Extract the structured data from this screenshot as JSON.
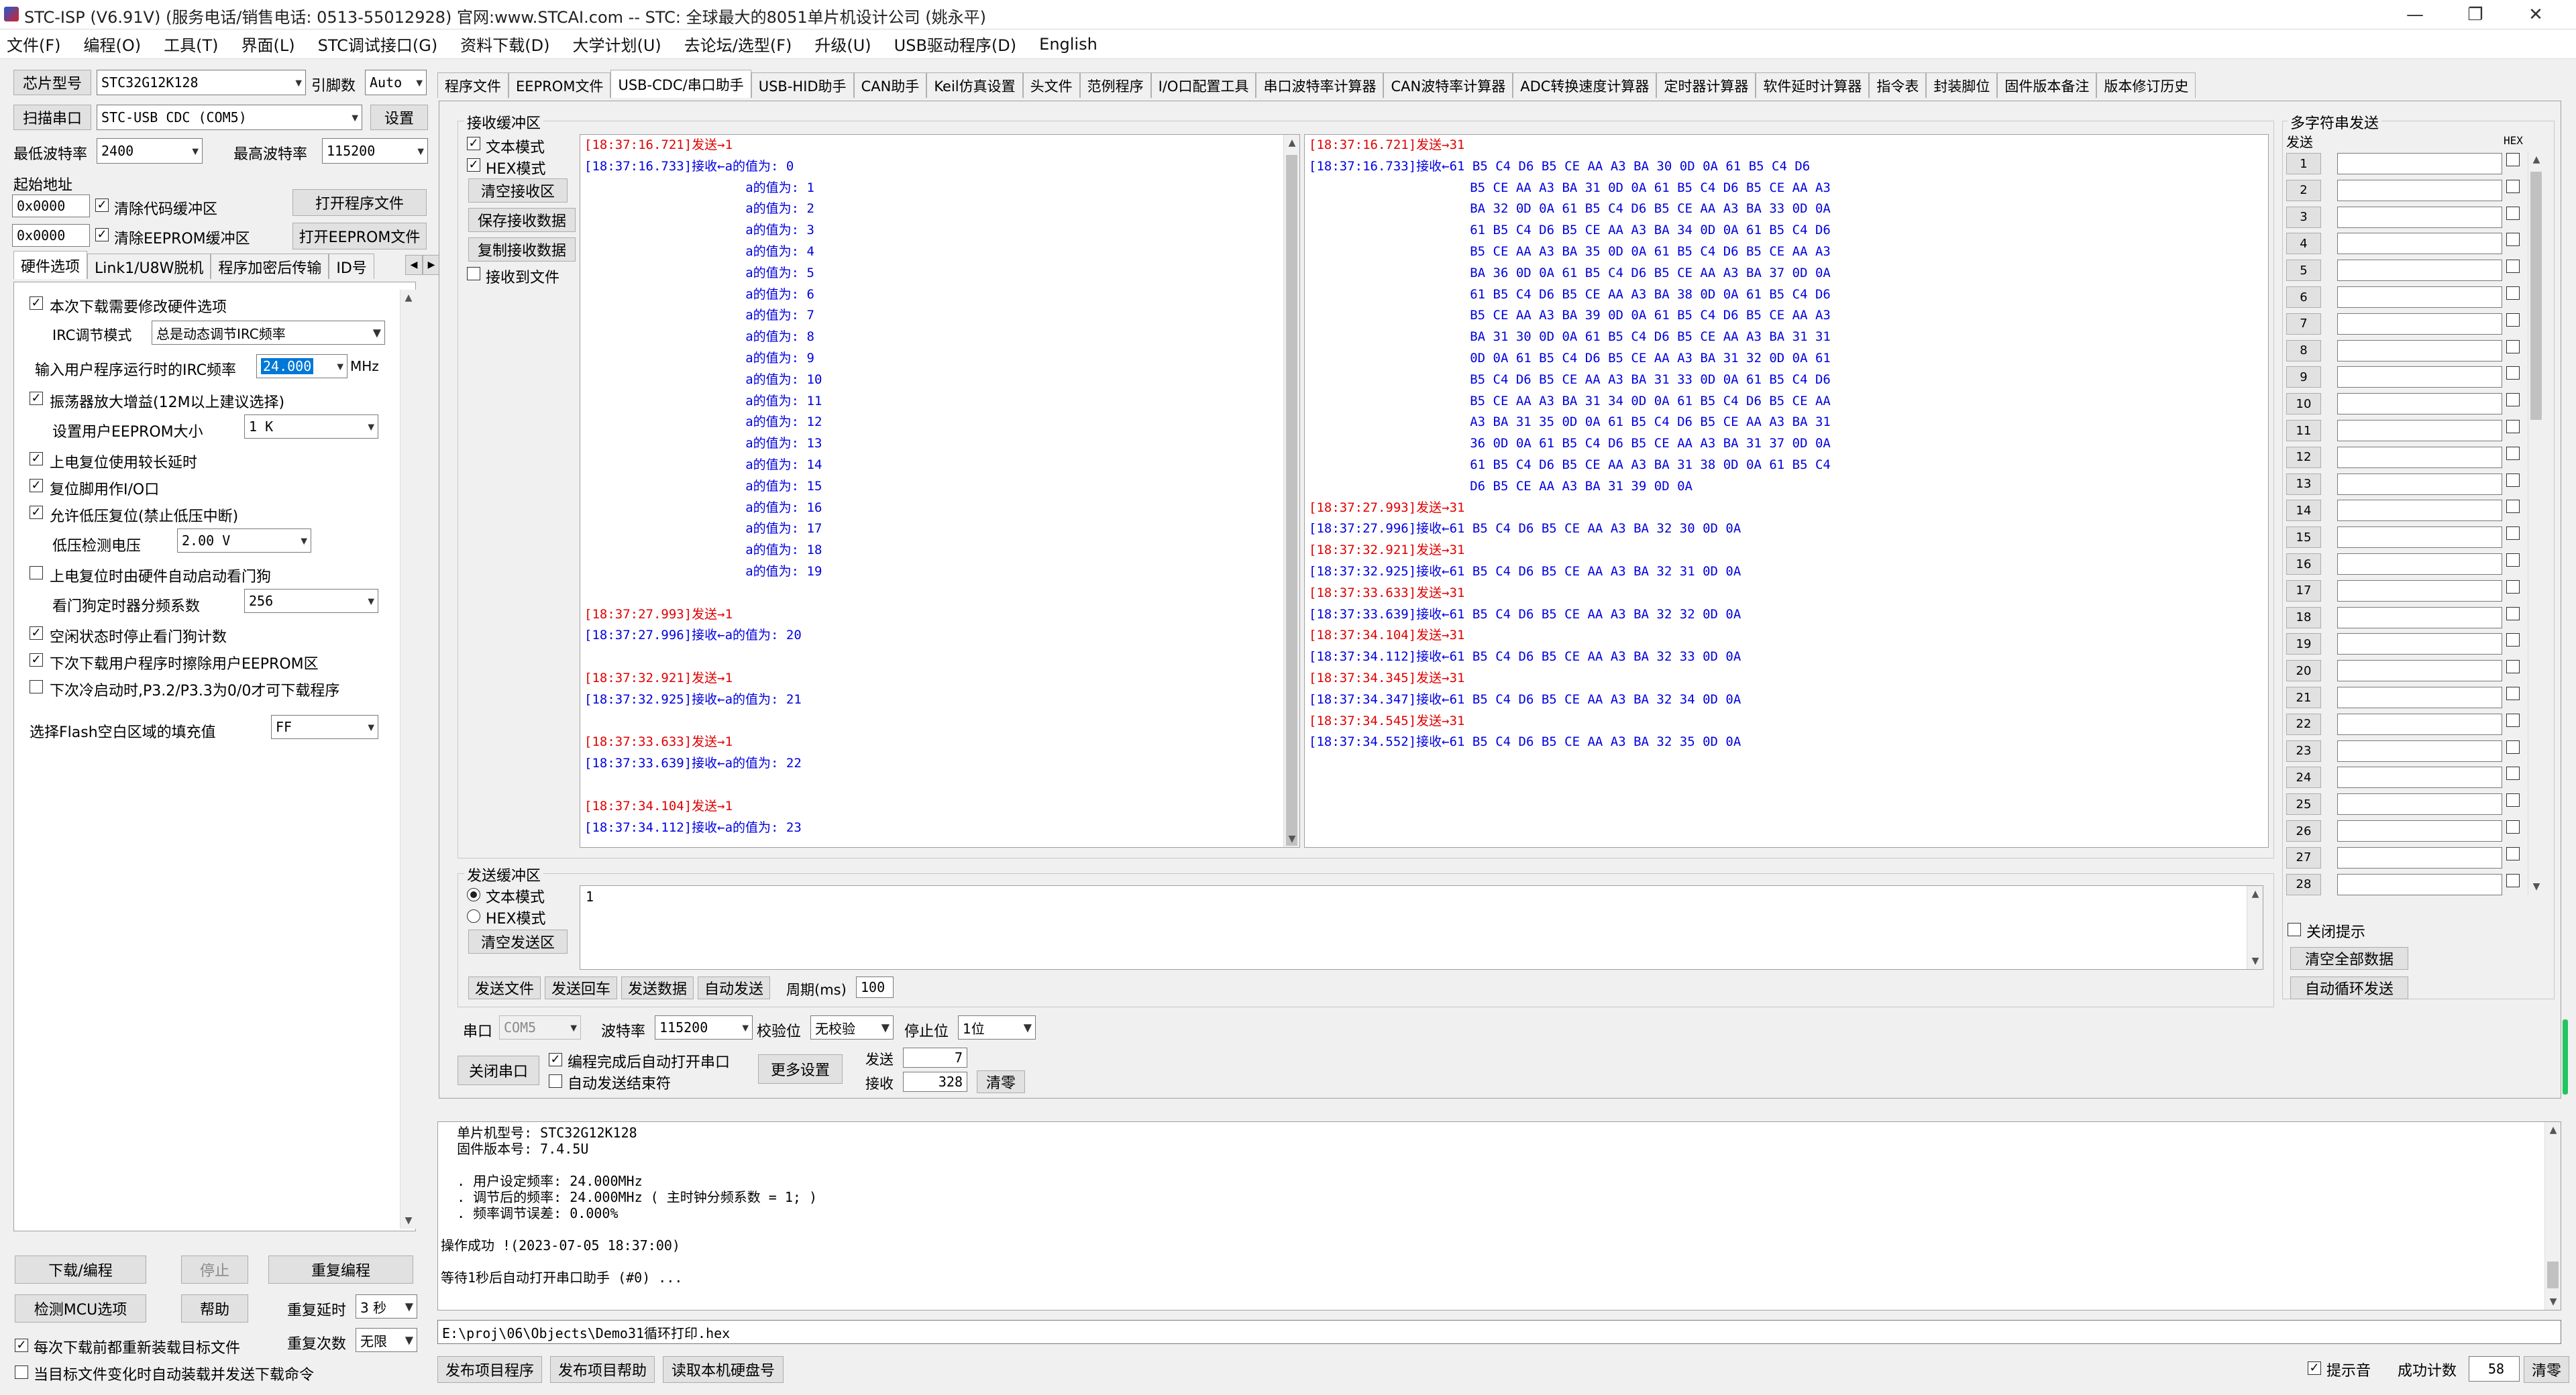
{
  "titlebar": {
    "title": "STC-ISP (V6.91V) (服务电话/销售电话: 0513-55012928) 官网:www.STCAI.com  -- STC: 全球最大的8051单片机设计公司 (姚永平)"
  },
  "menu": [
    "文件(F)",
    "编程(O)",
    "工具(T)",
    "界面(L)",
    "STC调试接口(G)",
    "资料下载(D)",
    "大学计划(U)",
    "去论坛/选型(F)",
    "升级(U)",
    "USB驱动程序(D)",
    "English"
  ],
  "left": {
    "chip_label": "芯片型号",
    "chip": "STC32G12K128",
    "pin_label": "引脚数",
    "pin": "Auto",
    "scan_label": "扫描串口",
    "port": "STC-USB CDC (COM5)",
    "settings_label": "设置",
    "min_baud_label": "最低波特率",
    "min_baud": "2400",
    "max_baud_label": "最高波特率",
    "max_baud": "115200",
    "start_addr_label": "起始地址",
    "addr1": "0x0000",
    "clear_code_label": "清除代码缓冲区",
    "open_prog_label": "打开程序文件",
    "addr2": "0x0000",
    "clear_eeprom_label": "清除EEPROM缓冲区",
    "open_eeprom_label": "打开EEPROM文件",
    "tabs": [
      "硬件选项",
      "Link1/U8W脱机",
      "程序加密后传输",
      "ID号"
    ],
    "options": {
      "modify_hw": "本次下载需要修改硬件选项",
      "irc_mode_label": "IRC调节模式",
      "irc_mode": "总是动态调节IRC频率",
      "irc_freq_label": "输入用户程序运行时的IRC频率",
      "irc_freq": "24.000",
      "irc_unit": "MHz",
      "osc_amp": "振荡器放大增益(12M以上建议选择)",
      "eeprom_size_label": "设置用户EEPROM大小",
      "eeprom_size": "1   K",
      "long_reset": "上电复位使用较长延时",
      "reset_io": "复位脚用作I/O口",
      "low_volt_reset": "允许低压复位(禁止低压中断)",
      "low_volt_label": "低压检测电压",
      "low_volt": "2.00 V",
      "wdt_hw": "上电复位时由硬件自动启动看门狗",
      "wdt_div_label": "看门狗定时器分频系数",
      "wdt_div": "256",
      "wdt_idle": "空闲状态时停止看门狗计数",
      "erase_eeprom": "下次下载用户程序时擦除用户EEPROM区",
      "cold_boot": "下次冷启动时,P3.2/P3.3为0/0才可下载程序",
      "fill_label": "选择Flash空白区域的填充值",
      "fill": "FF"
    },
    "download_label": "下载/编程",
    "stop_label": "停止",
    "reprogram_label": "重复编程",
    "detect_label": "检测MCU选项",
    "help_label": "帮助",
    "repeat_delay_label": "重复延时",
    "repeat_delay": "3 秒",
    "reload_label": "每次下载前都重新装载目标文件",
    "repeat_count_label": "重复次数",
    "repeat_count": "无限",
    "auto_load_label": "当目标文件变化时自动装载并发送下载命令"
  },
  "main_tabs": [
    "程序文件",
    "EEPROM文件",
    "USB-CDC/串口助手",
    "USB-HID助手",
    "CAN助手",
    "Keil仿真设置",
    "头文件",
    "范例程序",
    "I/O口配置工具",
    "串口波特率计算器",
    "CAN波特率计算器",
    "ADC转换速度计算器",
    "定时器计算器",
    "软件延时计算器",
    "指令表",
    "封装脚位",
    "固件版本备注",
    "版本修订历史"
  ],
  "recv": {
    "title": "接收缓冲区",
    "text_mode": "文本模式",
    "hex_mode": "HEX模式",
    "clear_label": "清空接收区",
    "save_label": "保存接收数据",
    "copy_label": "复制接收数据",
    "to_file_label": "接收到文件",
    "text_lines": [
      {
        "c": "red",
        "t": "[18:37:16.721]发送→1"
      },
      {
        "c": "blue",
        "t": "[18:37:16.733]接收←a的值为: 0"
      },
      {
        "c": "blue",
        "t": "                     a的值为: 1"
      },
      {
        "c": "blue",
        "t": "                     a的值为: 2"
      },
      {
        "c": "blue",
        "t": "                     a的值为: 3"
      },
      {
        "c": "blue",
        "t": "                     a的值为: 4"
      },
      {
        "c": "blue",
        "t": "                     a的值为: 5"
      },
      {
        "c": "blue",
        "t": "                     a的值为: 6"
      },
      {
        "c": "blue",
        "t": "                     a的值为: 7"
      },
      {
        "c": "blue",
        "t": "                     a的值为: 8"
      },
      {
        "c": "blue",
        "t": "                     a的值为: 9"
      },
      {
        "c": "blue",
        "t": "                     a的值为: 10"
      },
      {
        "c": "blue",
        "t": "                     a的值为: 11"
      },
      {
        "c": "blue",
        "t": "                     a的值为: 12"
      },
      {
        "c": "blue",
        "t": "                     a的值为: 13"
      },
      {
        "c": "blue",
        "t": "                     a的值为: 14"
      },
      {
        "c": "blue",
        "t": "                     a的值为: 15"
      },
      {
        "c": "blue",
        "t": "                     a的值为: 16"
      },
      {
        "c": "blue",
        "t": "                     a的值为: 17"
      },
      {
        "c": "blue",
        "t": "                     a的值为: 18"
      },
      {
        "c": "blue",
        "t": "                     a的值为: 19"
      },
      {
        "c": "blue",
        "t": " "
      },
      {
        "c": "red",
        "t": "[18:37:27.993]发送→1"
      },
      {
        "c": "blue",
        "t": "[18:37:27.996]接收←a的值为: 20"
      },
      {
        "c": "blue",
        "t": " "
      },
      {
        "c": "red",
        "t": "[18:37:32.921]发送→1"
      },
      {
        "c": "blue",
        "t": "[18:37:32.925]接收←a的值为: 21"
      },
      {
        "c": "blue",
        "t": " "
      },
      {
        "c": "red",
        "t": "[18:37:33.633]发送→1"
      },
      {
        "c": "blue",
        "t": "[18:37:33.639]接收←a的值为: 22"
      },
      {
        "c": "blue",
        "t": " "
      },
      {
        "c": "red",
        "t": "[18:37:34.104]发送→1"
      },
      {
        "c": "blue",
        "t": "[18:37:34.112]接收←a的值为: 23"
      }
    ],
    "hex_lines": [
      {
        "c": "red",
        "t": "[18:37:16.721]发送→31"
      },
      {
        "c": "blue",
        "t": "[18:37:16.733]接收←61 B5 C4 D6 B5 CE AA A3 BA 30 0D 0A 61 B5 C4 D6"
      },
      {
        "c": "blue",
        "t": "                     B5 CE AA A3 BA 31 0D 0A 61 B5 C4 D6 B5 CE AA A3"
      },
      {
        "c": "blue",
        "t": "                     BA 32 0D 0A 61 B5 C4 D6 B5 CE AA A3 BA 33 0D 0A"
      },
      {
        "c": "blue",
        "t": "                     61 B5 C4 D6 B5 CE AA A3 BA 34 0D 0A 61 B5 C4 D6"
      },
      {
        "c": "blue",
        "t": "                     B5 CE AA A3 BA 35 0D 0A 61 B5 C4 D6 B5 CE AA A3"
      },
      {
        "c": "blue",
        "t": "                     BA 36 0D 0A 61 B5 C4 D6 B5 CE AA A3 BA 37 0D 0A"
      },
      {
        "c": "blue",
        "t": "                     61 B5 C4 D6 B5 CE AA A3 BA 38 0D 0A 61 B5 C4 D6"
      },
      {
        "c": "blue",
        "t": "                     B5 CE AA A3 BA 39 0D 0A 61 B5 C4 D6 B5 CE AA A3"
      },
      {
        "c": "blue",
        "t": "                     BA 31 30 0D 0A 61 B5 C4 D6 B5 CE AA A3 BA 31 31"
      },
      {
        "c": "blue",
        "t": "                     0D 0A 61 B5 C4 D6 B5 CE AA A3 BA 31 32 0D 0A 61"
      },
      {
        "c": "blue",
        "t": "                     B5 C4 D6 B5 CE AA A3 BA 31 33 0D 0A 61 B5 C4 D6"
      },
      {
        "c": "blue",
        "t": "                     B5 CE AA A3 BA 31 34 0D 0A 61 B5 C4 D6 B5 CE AA"
      },
      {
        "c": "blue",
        "t": "                     A3 BA 31 35 0D 0A 61 B5 C4 D6 B5 CE AA A3 BA 31"
      },
      {
        "c": "blue",
        "t": "                     36 0D 0A 61 B5 C4 D6 B5 CE AA A3 BA 31 37 0D 0A"
      },
      {
        "c": "blue",
        "t": "                     61 B5 C4 D6 B5 CE AA A3 BA 31 38 0D 0A 61 B5 C4"
      },
      {
        "c": "blue",
        "t": "                     D6 B5 CE AA A3 BA 31 39 0D 0A"
      },
      {
        "c": "red",
        "t": "[18:37:27.993]发送→31"
      },
      {
        "c": "blue",
        "t": "[18:37:27.996]接收←61 B5 C4 D6 B5 CE AA A3 BA 32 30 0D 0A"
      },
      {
        "c": "red",
        "t": "[18:37:32.921]发送→31"
      },
      {
        "c": "blue",
        "t": "[18:37:32.925]接收←61 B5 C4 D6 B5 CE AA A3 BA 32 31 0D 0A"
      },
      {
        "c": "red",
        "t": "[18:37:33.633]发送→31"
      },
      {
        "c": "blue",
        "t": "[18:37:33.639]接收←61 B5 C4 D6 B5 CE AA A3 BA 32 32 0D 0A"
      },
      {
        "c": "red",
        "t": "[18:37:34.104]发送→31"
      },
      {
        "c": "blue",
        "t": "[18:37:34.112]接收←61 B5 C4 D6 B5 CE AA A3 BA 32 33 0D 0A"
      },
      {
        "c": "red",
        "t": "[18:37:34.345]发送→31"
      },
      {
        "c": "blue",
        "t": "[18:37:34.347]接收←61 B5 C4 D6 B5 CE AA A3 BA 32 34 0D 0A"
      },
      {
        "c": "red",
        "t": "[18:37:34.545]发送→31"
      },
      {
        "c": "blue",
        "t": "[18:37:34.552]接收←61 B5 C4 D6 B5 CE AA A3 BA 32 35 0D 0A"
      }
    ]
  },
  "multi": {
    "title": "多字符串发送",
    "send_label": "发送",
    "hex_label": "HEX",
    "rows": [
      "1",
      "2",
      "3",
      "4",
      "5",
      "6",
      "7",
      "8",
      "9",
      "10",
      "11",
      "12",
      "13",
      "14",
      "15",
      "16",
      "17",
      "18",
      "19",
      "20",
      "21",
      "22",
      "23",
      "24",
      "25",
      "26",
      "27",
      "28"
    ],
    "close_hint_label": "关闭提示",
    "clear_all_label": "清空全部数据",
    "auto_loop_label": "自动循环发送"
  },
  "send": {
    "title": "发送缓冲区",
    "text_mode": "文本模式",
    "hex_mode": "HEX模式",
    "clear_label": "清空发送区",
    "content": "1",
    "send_file_label": "发送文件",
    "send_enter_label": "发送回车",
    "send_data_label": "发送数据",
    "auto_send_label": "自动发送",
    "period_label": "周期(ms)",
    "period": "100"
  },
  "serial": {
    "port_label": "串口",
    "port": "COM5",
    "baud_label": "波特率",
    "baud": "115200",
    "parity_label": "校验位",
    "parity": "无校验",
    "stop_label": "停止位",
    "stop": "1位",
    "close_label": "关闭串口",
    "auto_open_label": "编程完成后自动打开串口",
    "auto_end_label": "自动发送结束符",
    "more_label": "更多设置",
    "sent_label": "发送",
    "sent": "7",
    "recv_label": "接收",
    "recv": "328",
    "clear_label": "清零"
  },
  "log": {
    "lines": [
      "  单片机型号: STC32G12K128",
      "  固件版本号: 7.4.5U",
      " ",
      "  . 用户设定频率: 24.000MHz",
      "  . 调节后的频率: 24.000MHz ( 主时钟分频系数 = 1; )",
      "  . 频率调节误差: 0.000%",
      " ",
      "操作成功 !(2023-07-05 18:37:00)",
      " ",
      "等待1秒后自动打开串口助手 (#0) ..."
    ]
  },
  "file_path": "E:\\proj\\06\\Objects\\Demo31循环打印.hex",
  "bottom": {
    "publish_label": "发布项目程序",
    "publish_help_label": "发布项目帮助",
    "read_disk_label": "读取本机硬盘号",
    "beep_label": "提示音",
    "success_label": "成功计数",
    "success": "58",
    "clear_label": "清零"
  }
}
